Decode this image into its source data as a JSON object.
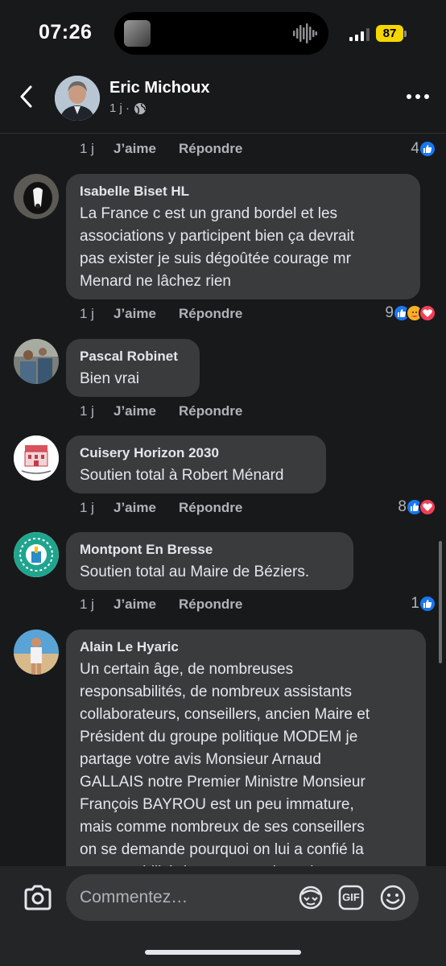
{
  "status_bar": {
    "time": "07:26",
    "battery": "87"
  },
  "header": {
    "name": "Eric Michoux",
    "meta": "1 j ·",
    "globe_icon": "globe-icon"
  },
  "action_labels": {
    "like": "J’aime",
    "reply": "Répondre"
  },
  "top_row": {
    "when": "1 j",
    "reaction_count": "4"
  },
  "comments": [
    {
      "author": "Isabelle Biset HL",
      "text": "La France  c est un grand bordel et les\nassociations  y participent bien  ça devrait\npas exister je suis dégoûtée courage mr\nMenard ne lâchez rien",
      "when": "1 j",
      "reaction_count": "9",
      "reactions": [
        "like",
        "care",
        "love"
      ]
    },
    {
      "author": "Pascal Robinet",
      "text": "Bien vrai",
      "when": "1 j",
      "reaction_count": "",
      "reactions": []
    },
    {
      "author": "Cuisery Horizon 2030",
      "text": "Soutien total à Robert Ménard",
      "when": "1 j",
      "reaction_count": "8",
      "reactions": [
        "like",
        "love"
      ]
    },
    {
      "author": "Montpont En Bresse",
      "text": "Soutien total au Maire de Béziers.",
      "when": "1 j",
      "reaction_count": "1",
      "reactions": [
        "like"
      ]
    },
    {
      "author": "Alain Le Hyaric",
      "text": "Un certain âge, de nombreuses\nresponsabilités, de nombreux assistants\ncollaborateurs, conseillers, ancien Maire et\nPrésident du groupe politique MODEM je\npartage votre avis Monsieur Arnaud\nGALLAIS notre Premier Ministre Monsieur\nFrançois BAYROU est un peu immature,\nmais comme nombreux de ses conseillers\non se demande pourquoi on lui a confié la\nresponsabilité de gouverner la nation",
      "when": "",
      "reaction_count": "",
      "reactions": []
    }
  ],
  "composer": {
    "placeholder": "Commentez…",
    "gif_label": "GIF"
  },
  "colors": {
    "background": "#18191a",
    "bubble": "#3a3b3c",
    "like_blue": "#1877f2",
    "love_red": "#f33e58",
    "battery": "#f5d600"
  }
}
